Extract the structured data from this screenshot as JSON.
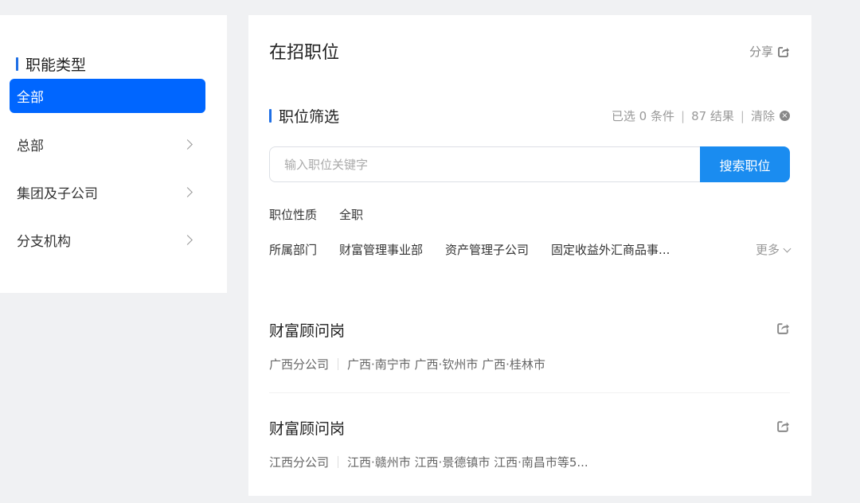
{
  "sidebar": {
    "title": "职能类型",
    "items": [
      {
        "label": "全部",
        "active": true
      },
      {
        "label": "总部",
        "active": false
      },
      {
        "label": "集团及子公司",
        "active": false
      },
      {
        "label": "分支机构",
        "active": false
      }
    ]
  },
  "main": {
    "title": "在招职位",
    "share_label": "分享",
    "filter": {
      "title": "职位筛选",
      "selected": "已选 0 条件",
      "results": "87 结果",
      "clear": "清除",
      "search_placeholder": "输入职位关键字",
      "search_button": "搜索职位",
      "nature_label": "职位性质",
      "nature_options": [
        "全职"
      ],
      "dept_label": "所属部门",
      "dept_options": [
        "财富管理事业部",
        "资产管理子公司",
        "固定收益外汇商品事..."
      ],
      "more": "更多"
    },
    "jobs": [
      {
        "title": "财富顾问岗",
        "company": "广西分公司",
        "locations": "广西·南宁市 广西·钦州市 广西·桂林市"
      },
      {
        "title": "财富顾问岗",
        "company": "江西分公司",
        "locations": "江西·赣州市 江西·景德镇市 江西·南昌市等5..."
      }
    ]
  },
  "colors": {
    "accent": "#0066ff",
    "button": "#1a8cf0",
    "bar": "#1f6fe5",
    "background": "#f0f1f3"
  }
}
